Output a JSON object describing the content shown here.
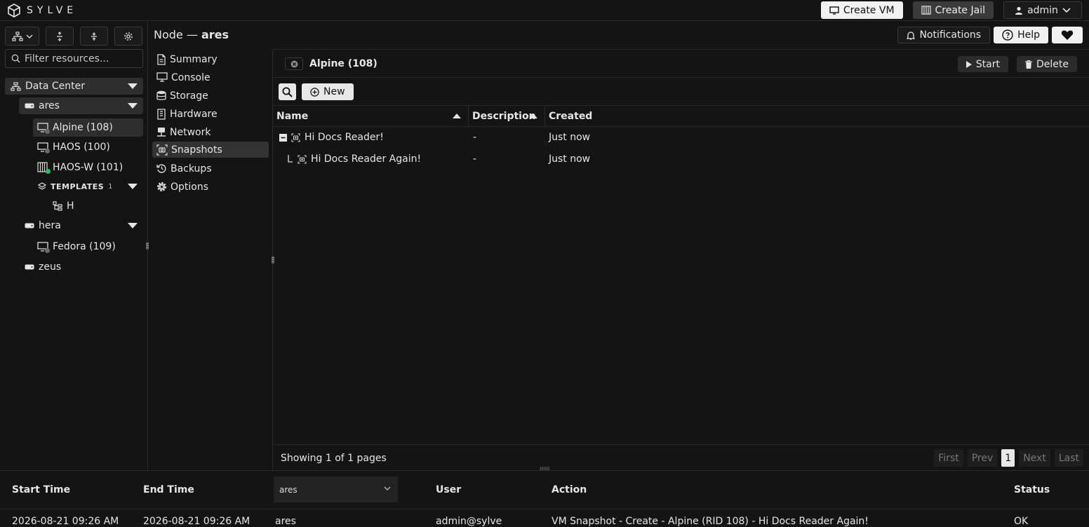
{
  "app": {
    "brand": "SYLVE"
  },
  "topbar": {
    "create_vm": "Create VM",
    "create_jail": "Create Jail",
    "user": "admin",
    "notifications": "Notifications",
    "help": "Help"
  },
  "sidebar": {
    "filter_placeholder": "Filter resources...",
    "datacenter": "Data Center",
    "nodes": [
      {
        "name": "ares",
        "items": [
          {
            "label": "Alpine (108)",
            "status": "stopped"
          },
          {
            "label": "HAOS (100)",
            "status": "stopped"
          },
          {
            "label": "HAOS-W (101)",
            "status": "running"
          }
        ]
      },
      {
        "name": "hera",
        "items": [
          {
            "label": "Fedora (109)",
            "status": "stopped"
          }
        ]
      },
      {
        "name": "zeus",
        "items": []
      }
    ],
    "templates_label": "TEMPLATES",
    "templates_count": "1",
    "template_item": "H"
  },
  "node_header": {
    "prefix": "Node —",
    "name": "ares"
  },
  "nav": [
    "Summary",
    "Console",
    "Storage",
    "Hardware",
    "Network",
    "Snapshots",
    "Backups",
    "Options"
  ],
  "panel": {
    "title": "Alpine (108)",
    "start": "Start",
    "delete": "Delete",
    "new": "New",
    "columns": {
      "name": "Name",
      "description": "Description",
      "created": "Created"
    },
    "rows": [
      {
        "name": "Hi Docs Reader!",
        "description": "-",
        "created": "Just now"
      },
      {
        "name": "Hi Docs Reader Again!",
        "description": "-",
        "created": "Just now"
      }
    ],
    "showing": "Showing 1 of 1 pages",
    "pager": {
      "first": "First",
      "prev": "Prev",
      "current": "1",
      "next": "Next",
      "last": "Last"
    }
  },
  "tasks": {
    "columns": {
      "start": "Start Time",
      "end": "End Time",
      "node": "ares",
      "user": "User",
      "action": "Action",
      "status": "Status"
    },
    "rows": [
      {
        "start": "2026-08-21 09:26 AM",
        "end": "2026-08-21 09:26 AM",
        "node": "ares",
        "user": "admin@sylve",
        "action": "VM Snapshot - Create - Alpine (RID 108) - Hi Docs Reader Again!",
        "status": "OK"
      }
    ]
  },
  "colors": {
    "bg": "#141414",
    "border": "#2a2a2a",
    "running": "#22c55e",
    "stopped": "#6b6b6b"
  }
}
